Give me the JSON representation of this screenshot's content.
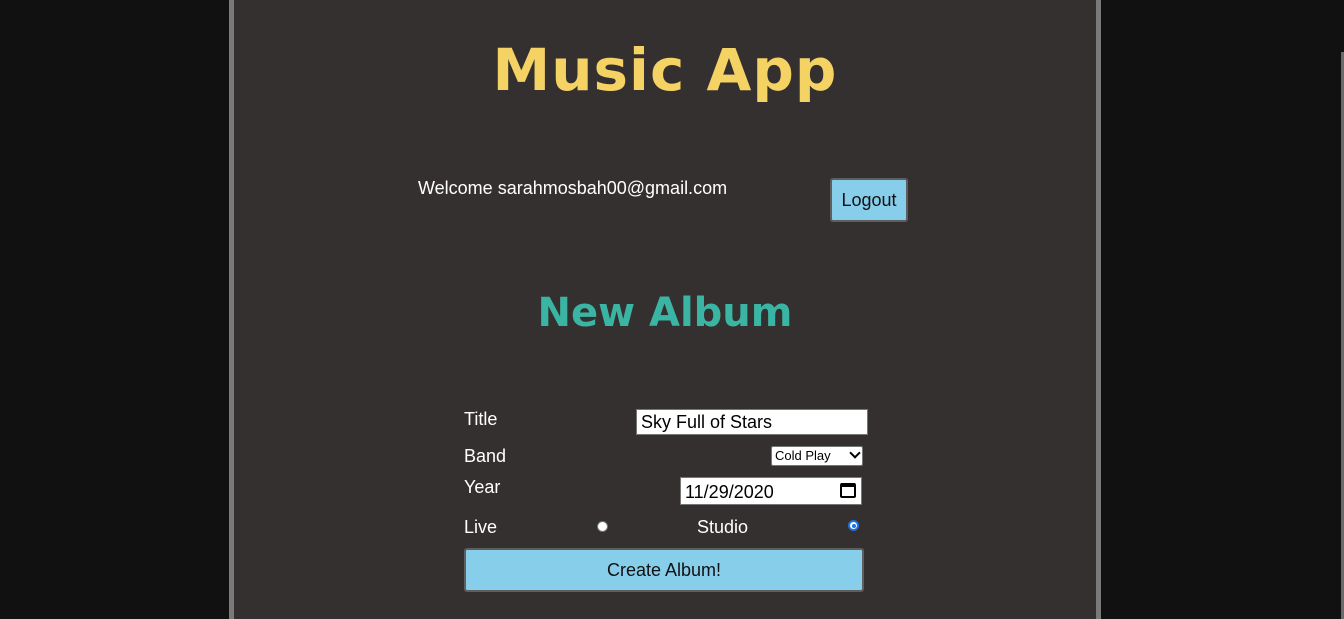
{
  "app": {
    "title": "Music App"
  },
  "header": {
    "welcome_text": "Welcome sarahmosbah00@gmail.com",
    "logout_label": "Logout"
  },
  "form": {
    "heading": "New Album",
    "title_label": "Title",
    "title_value": "Sky Full of Stars",
    "band_label": "Band",
    "band_selected": "Cold Play",
    "year_label": "Year",
    "year_value": "11/29/2020",
    "live_label": "Live",
    "live_selected": false,
    "studio_label": "Studio",
    "studio_selected": true,
    "submit_label": "Create Album!"
  },
  "colors": {
    "background": "#111111",
    "panel": "#353030",
    "title": "#f5d264",
    "heading": "#3bb5a3",
    "button": "#87ceeb"
  },
  "icons": {
    "calendar": "calendar-icon",
    "dropdown": "chevron-down-icon"
  }
}
